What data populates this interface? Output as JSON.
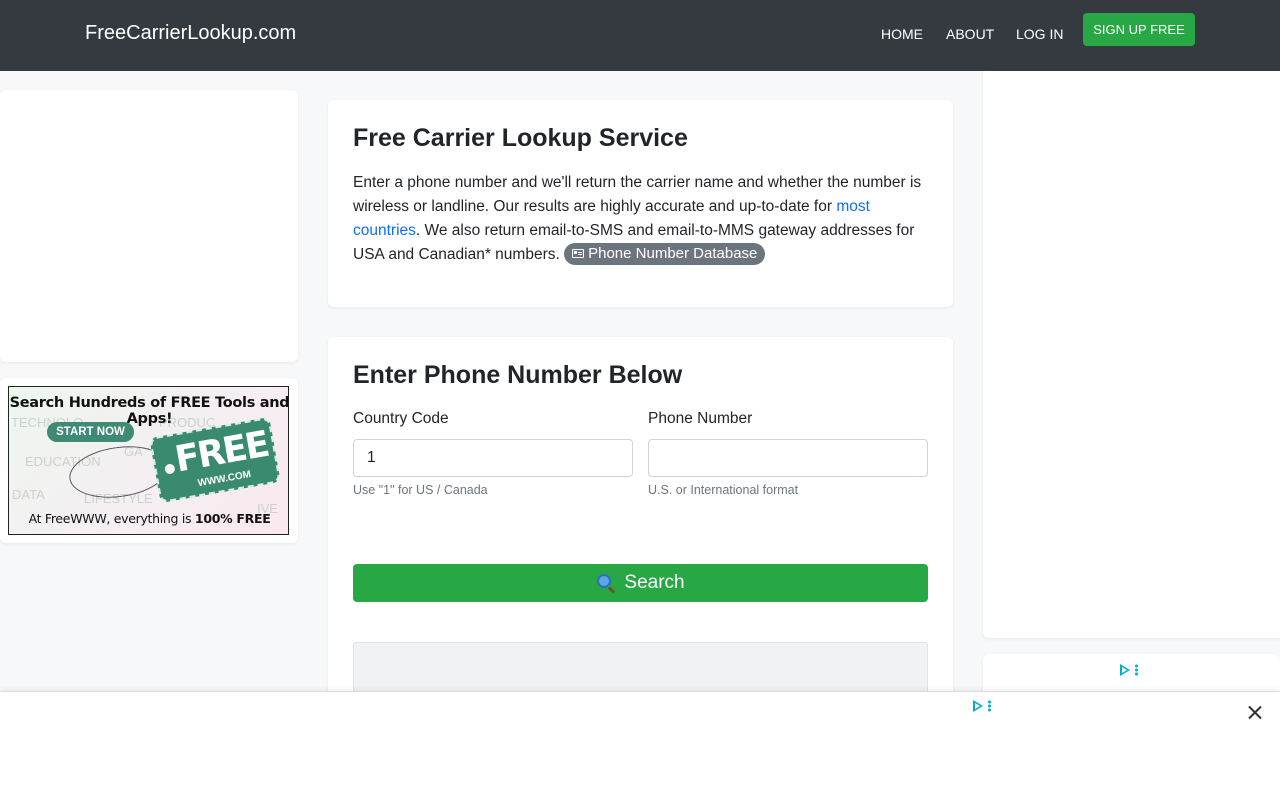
{
  "navbar": {
    "brand": "FreeCarrierLookup.com",
    "links": {
      "home": "HOME",
      "about": "ABOUT",
      "login": "LOG IN"
    },
    "signup_label": "SIGN UP FREE"
  },
  "intro": {
    "title": "Free Carrier Lookup Service",
    "text_part1": "Enter a phone number and we'll return the carrier name and whether the number is wireless or landline. Our results are highly accurate and up-to-date for ",
    "link_label": "most countries",
    "text_part2": ". We also return email-to-SMS and email-to-MMS gateway addresses for USA and Canadian* numbers. ",
    "badge_label": "Phone Number Database"
  },
  "form": {
    "title": "Enter Phone Number Below",
    "country_code": {
      "label": "Country Code",
      "value": "1",
      "help": "Use \"1\" for US / Canada"
    },
    "phone_number": {
      "label": "Phone Number",
      "value": "",
      "help": "U.S. or International format"
    },
    "search_label": "Search"
  },
  "banner_ad": {
    "headline": "Search Hundreds of FREE Tools and Apps!",
    "cta": "START NOW",
    "tag_big": "FREE",
    "tag_small": "WWW.COM",
    "footer_prefix": "At FreeWWW, everything is ",
    "footer_emphasis": "100% FREE",
    "bg_words": [
      "TECHNOLO",
      "PRODUC",
      "EDUCATION",
      "GA",
      "DATA",
      "LIFESTYLE",
      "IVE"
    ]
  },
  "colors": {
    "navbar_bg": "#343a40",
    "success": "#28a745",
    "link": "#0d6efd",
    "badge_bg": "#6c757d",
    "adchoices": "#00aecd"
  },
  "icons": {
    "search_button": "magnifying-glass-icon",
    "badge": "address-card-icon",
    "ad_choices": "adchoices-icon",
    "ad_close": "close-icon"
  }
}
